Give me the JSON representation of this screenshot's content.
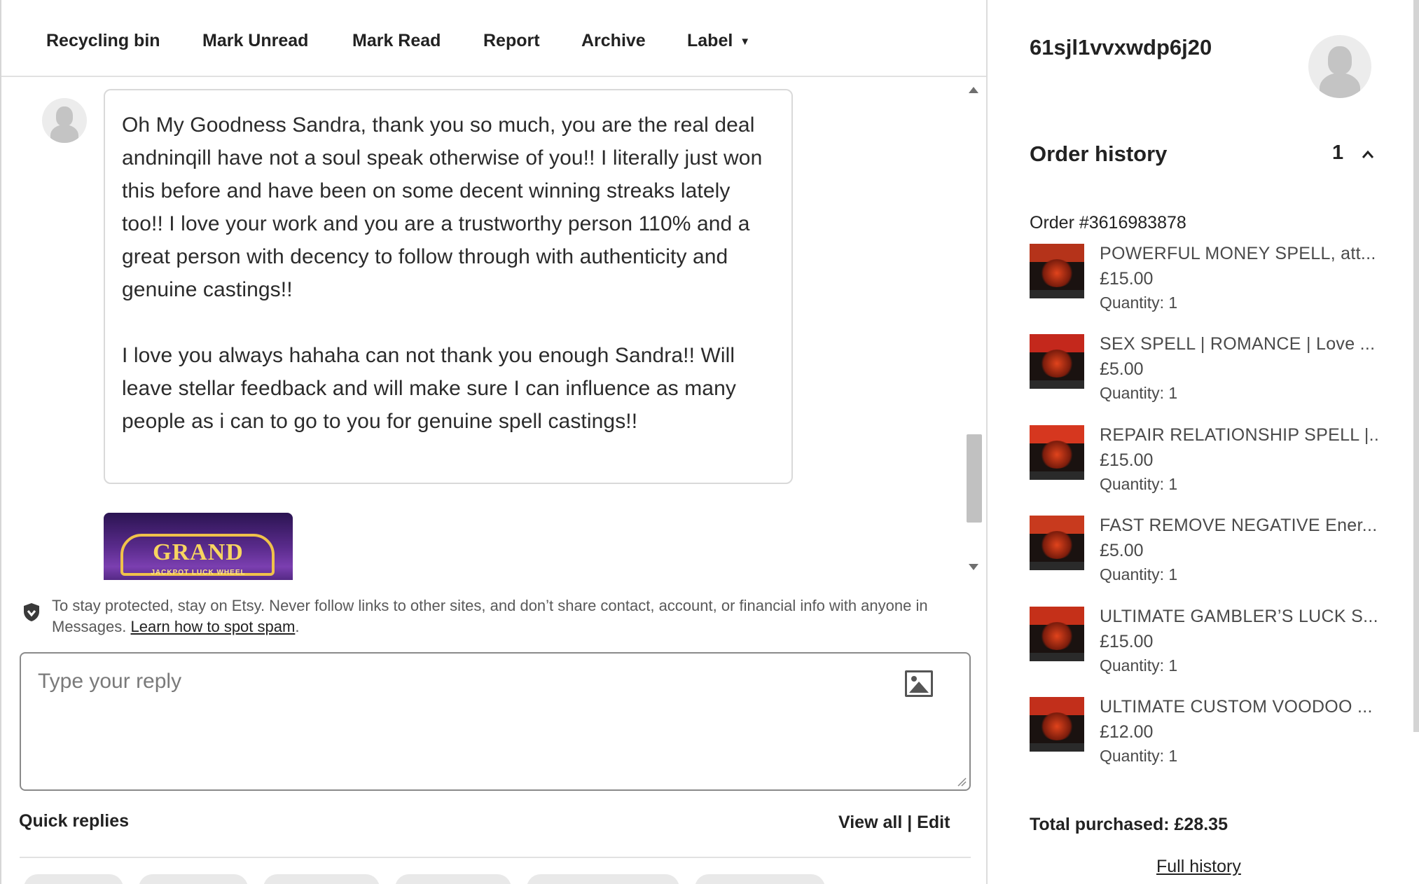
{
  "toolbar": {
    "recycling_bin": "Recycling bin",
    "mark_unread": "Mark Unread",
    "mark_read": "Mark Read",
    "report": "Report",
    "archive": "Archive",
    "label": "Label"
  },
  "conversation": {
    "message_paragraph_1": "Oh My Goodness Sandra, thank you so much, you are the real deal andninqill have not a soul speak otherwise of you!! I literally just won this before and have been on some decent winning streaks lately too!! I love your work and you are a trustworthy person 110% and a great person with decency to follow through with authenticity and genuine castings!!",
    "message_paragraph_2": "I love you always hahaha can not thank you enough Sandra!! Will leave stellar feedback and will make sure I can influence as many people as i can to go to you for genuine spell castings!!",
    "attachment_text": "GRAND",
    "attachment_subtext": "JACKPOT LUCK WHEEL"
  },
  "compose": {
    "safety_notice": "To stay protected, stay on Etsy. Never follow links to other sites, and don’t share contact, account, or financial info with anyone in Messages.",
    "learn_link": "Learn how to spot spam",
    "reply_placeholder": "Type your reply",
    "quick_replies_label": "Quick replies",
    "view_all": "View all",
    "separator": "|",
    "edit": "Edit"
  },
  "sidebar": {
    "buyer_name": "61sjl1vvxwdp6j20",
    "order_history_title": "Order history",
    "order_count": "1",
    "order_number": "Order #3616983878",
    "items": [
      {
        "title": "POWERFUL MONEY SPELL, att...",
        "price": "£15.00",
        "quantity": "Quantity: 1",
        "thumb_color": "#b5331a"
      },
      {
        "title": "SEX SPELL | ROMANCE | Love ...",
        "price": "£5.00",
        "quantity": "Quantity: 1",
        "thumb_color": "#c4281c"
      },
      {
        "title": "REPAIR RELATIONSHIP SPELL |...",
        "price": "£15.00",
        "quantity": "Quantity: 1",
        "thumb_color": "#d6371f"
      },
      {
        "title": "FAST REMOVE NEGATIVE Ener...",
        "price": "£5.00",
        "quantity": "Quantity: 1",
        "thumb_color": "#c83a1e"
      },
      {
        "title": "ULTIMATE GAMBLER’S LUCK S...",
        "price": "£15.00",
        "quantity": "Quantity: 1",
        "thumb_color": "#c53019"
      },
      {
        "title": "ULTIMATE CUSTOM VOODOO ...",
        "price": "£12.00",
        "quantity": "Quantity: 1",
        "thumb_color": "#c22f1b"
      }
    ],
    "total_purchased": "Total purchased: £28.35",
    "full_history": "Full history"
  },
  "colors": {
    "primary_text": "#222222",
    "secondary_text": "#4a4a4a",
    "border": "#d9d9d9",
    "scroll_thumb": "#c1c1c1"
  }
}
